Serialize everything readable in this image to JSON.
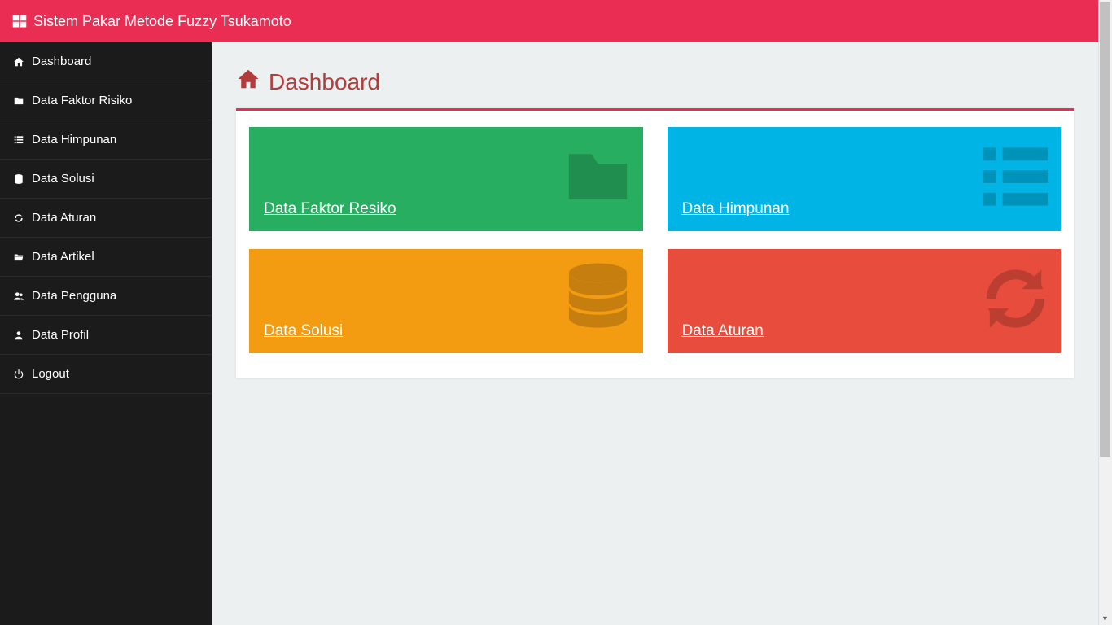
{
  "app": {
    "title": "Sistem Pakar Metode Fuzzy Tsukamoto"
  },
  "page": {
    "title": "Dashboard"
  },
  "sidebar": {
    "items": [
      {
        "label": "Dashboard"
      },
      {
        "label": "Data Faktor Risiko"
      },
      {
        "label": "Data Himpunan"
      },
      {
        "label": "Data Solusi"
      },
      {
        "label": "Data Aturan"
      },
      {
        "label": "Data Artikel"
      },
      {
        "label": "Data Pengguna"
      },
      {
        "label": "Data Profil"
      },
      {
        "label": "Logout"
      }
    ]
  },
  "cards": {
    "faktor": {
      "label": "Data Faktor Resiko"
    },
    "himpunan": {
      "label": "Data Himpunan"
    },
    "solusi": {
      "label": "Data Solusi"
    },
    "aturan": {
      "label": "Data Aturan"
    }
  }
}
